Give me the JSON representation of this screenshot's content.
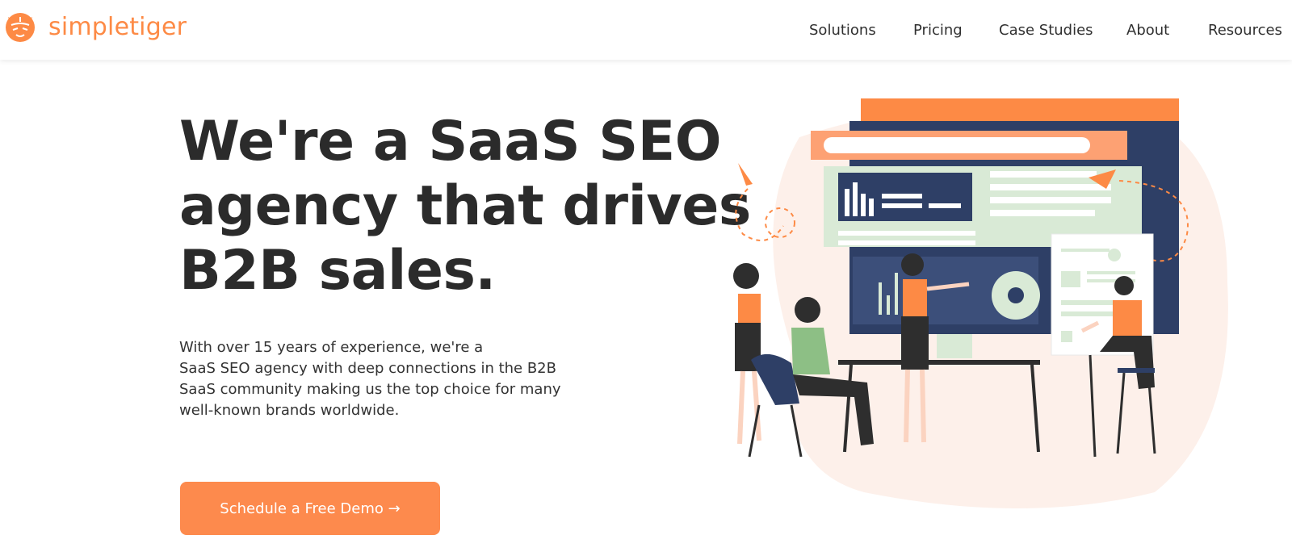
{
  "header": {
    "logo_text": "simpletiger",
    "nav": {
      "solutions": "Solutions",
      "pricing": "Pricing",
      "case_studies": "Case Studies",
      "about": "About",
      "resources": "Resources"
    }
  },
  "hero": {
    "title_lines": [
      "We're a SaaS SEO",
      "agency that drives",
      "B2B sales."
    ],
    "description_lines": [
      "With over 15 years of experience, we're a",
      "SaaS SEO agency with deep connections in the B2B",
      "SaaS community making us the top choice for many",
      "well-known brands worldwide."
    ],
    "cta_label": "Schedule a Free Demo →"
  },
  "colors": {
    "brand_orange": "#fd8a45",
    "dark_navy": "#2e3f66",
    "light_green": "#d9ead6",
    "text_dark": "#2b2b2b"
  },
  "icons": {
    "logo": "tiger-head-icon"
  }
}
